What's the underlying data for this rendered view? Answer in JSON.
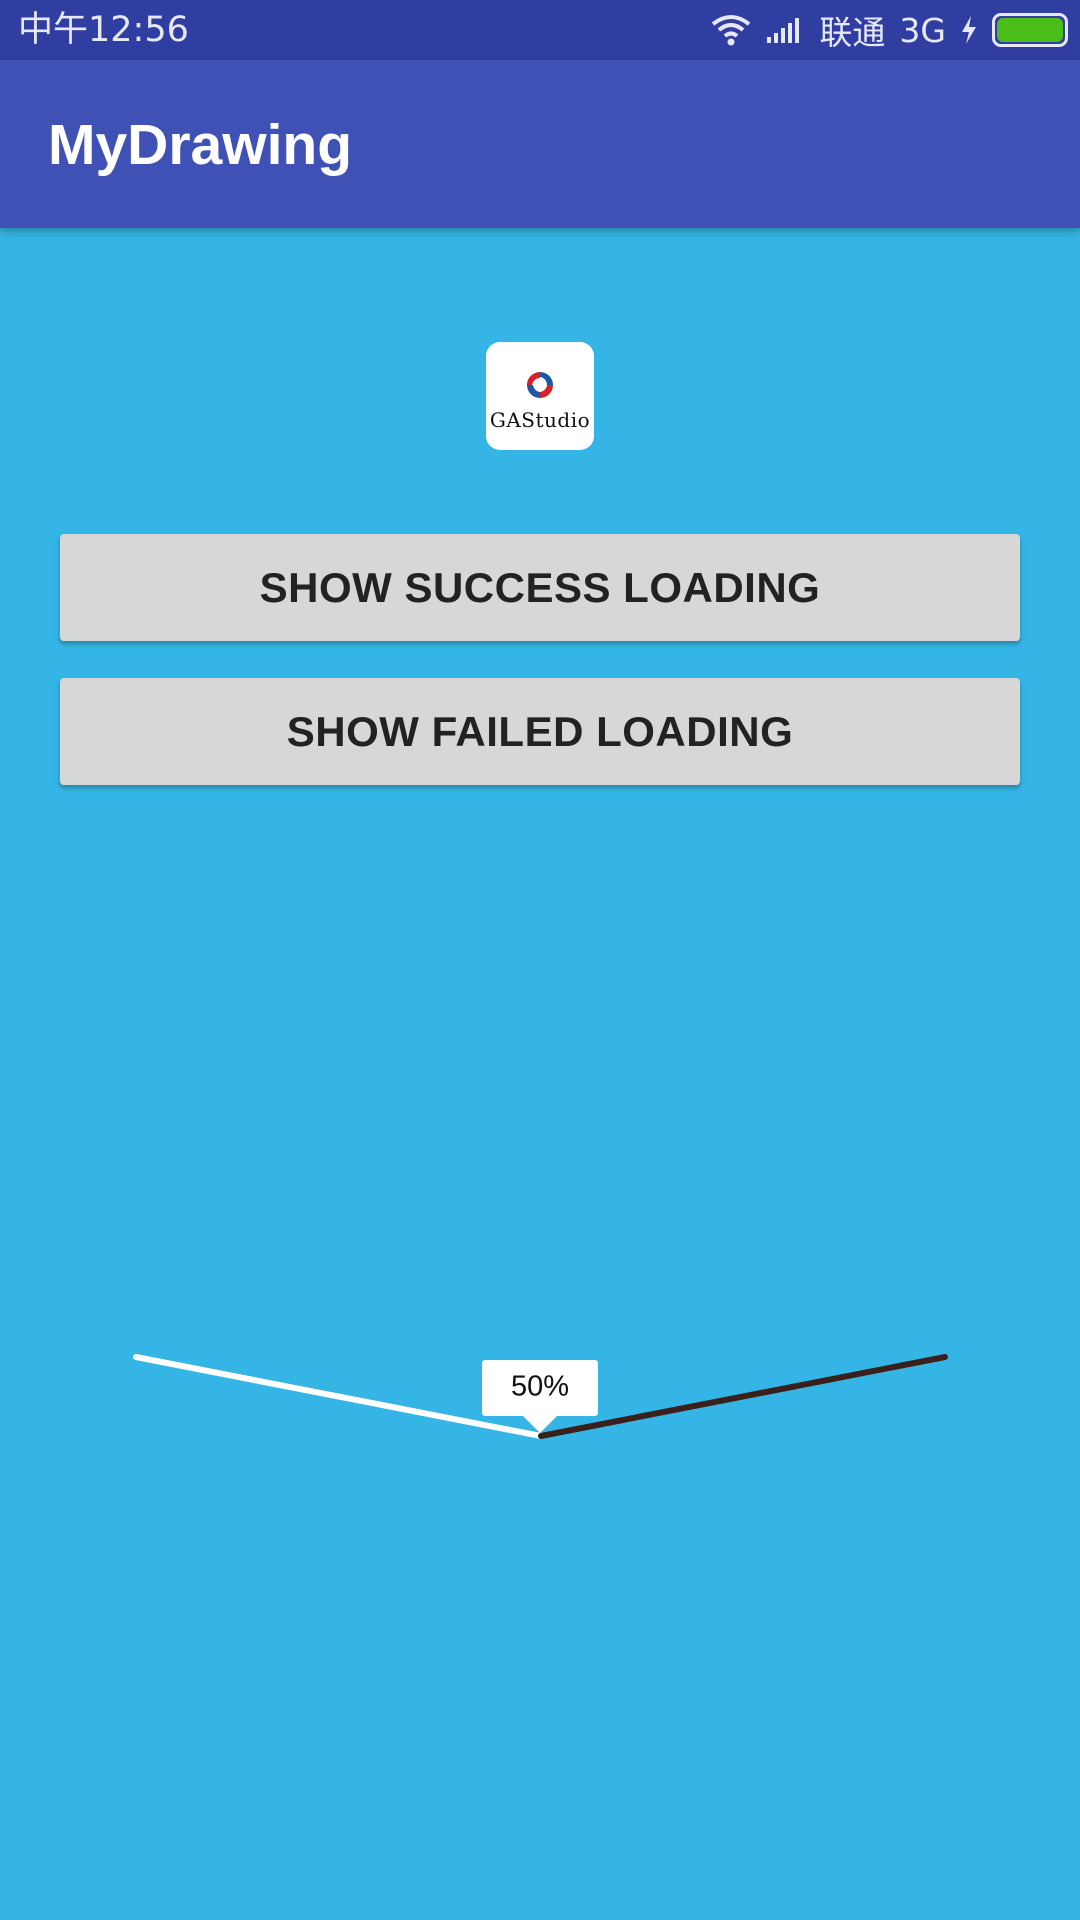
{
  "status_bar": {
    "time": "中午12:56",
    "carrier": "联通",
    "network": "3G",
    "battery_color": "#4cbe19"
  },
  "app_bar": {
    "title": "MyDrawing",
    "color": "#3f51b5"
  },
  "logo": {
    "text": "GAStudio"
  },
  "buttons": {
    "success_label": "SHOW SUCCESS LOADING",
    "failed_label": "SHOW FAILED LOADING"
  },
  "progress": {
    "label": "50%",
    "value": 0.5,
    "completed_color": "#ffffff",
    "remaining_color": "#3a1f1a"
  },
  "background_color": "#35b5e5"
}
